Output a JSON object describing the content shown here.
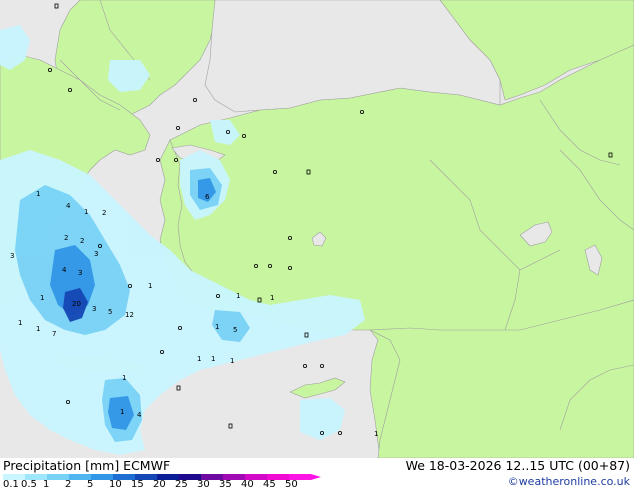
{
  "footer": {
    "title": "Precipitation [mm] ECMWF",
    "datetime": "We 18-03-2026 12..15 UTC (00+87)",
    "credit": "©weatheronline.co.uk"
  },
  "legend": {
    "labels": [
      "0.1",
      "0.5",
      "1",
      "2",
      "5",
      "10",
      "15",
      "20",
      "25",
      "30",
      "35",
      "40",
      "45",
      "50"
    ],
    "colors": [
      "#c8f5ff",
      "#a0e6fa",
      "#78d2f5",
      "#50b4f0",
      "#3296e6",
      "#1e6ed2",
      "#1446b4",
      "#0a1e96",
      "#1e0a8c",
      "#6e0aa0",
      "#a00ab4",
      "#d20ac8",
      "#f00ad2",
      "#ff14e6"
    ]
  },
  "colors": {
    "land": "#c8f5a0",
    "sea": "#e8e8e8",
    "borders": "#a0a0a0",
    "accent_credit": "#1e3ca0"
  },
  "map_labels": [
    "4",
    "1",
    "2",
    "2",
    "2",
    "4",
    "3",
    "20",
    "3",
    "5",
    "12",
    "7",
    "1",
    "1",
    "5",
    "1",
    "1",
    "1",
    "1",
    "6",
    "1",
    "4",
    "3",
    "3",
    "1",
    "1",
    "1",
    "1",
    "1",
    "1",
    "1"
  ]
}
